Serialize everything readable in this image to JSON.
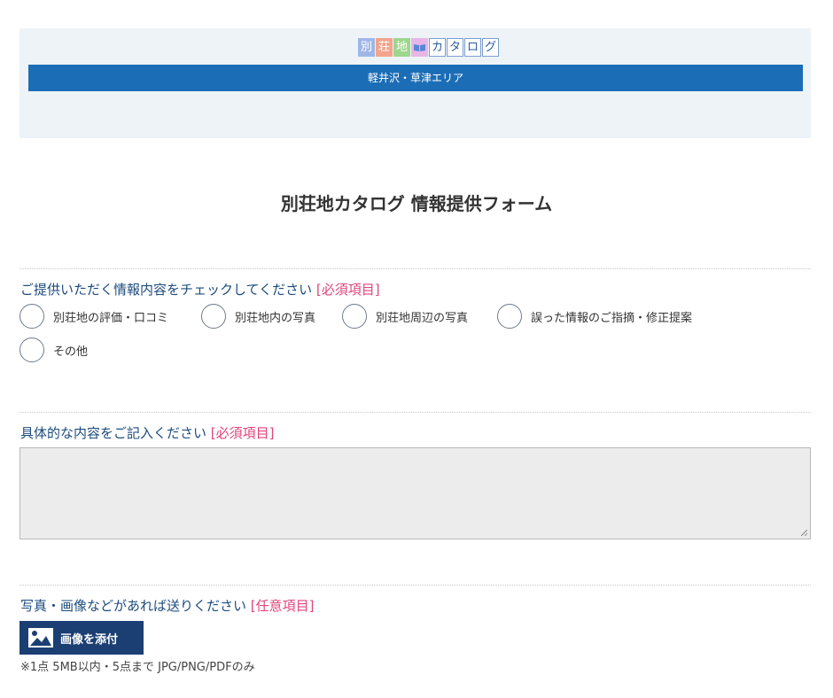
{
  "header": {
    "logo_kanji": [
      "別",
      "荘",
      "地"
    ],
    "logo_kana": [
      "カ",
      "タ",
      "ロ",
      "グ"
    ],
    "area": "軽井沢・草津エリア"
  },
  "page_title": "別荘地カタログ 情報提供フォーム",
  "q1": {
    "label": "ご提供いただく情報内容をチェックしてください",
    "required": "[必須項目]",
    "options": [
      "別荘地の評価・口コミ",
      "別荘地内の写真",
      "別荘地周辺の写真",
      "誤った情報のご指摘・修正提案",
      "その他"
    ]
  },
  "q2": {
    "label": "具体的な内容をご記入ください",
    "required": "[必須項目]",
    "value": ""
  },
  "q3": {
    "label": "写真・画像などがあれば送りください",
    "optional": "[任意項目]",
    "attach_label": "画像を添付",
    "note": "※1点 5MB以内・5点まで JPG/PNG/PDFのみ"
  },
  "icons": {
    "attach": "image-icon",
    "logo_book": "book-icon"
  },
  "colors": {
    "brand_blue": "#1b6db6",
    "button_navy": "#1b3f73",
    "required_pink": "#e0457b",
    "label_navy": "#1c4b7d"
  }
}
